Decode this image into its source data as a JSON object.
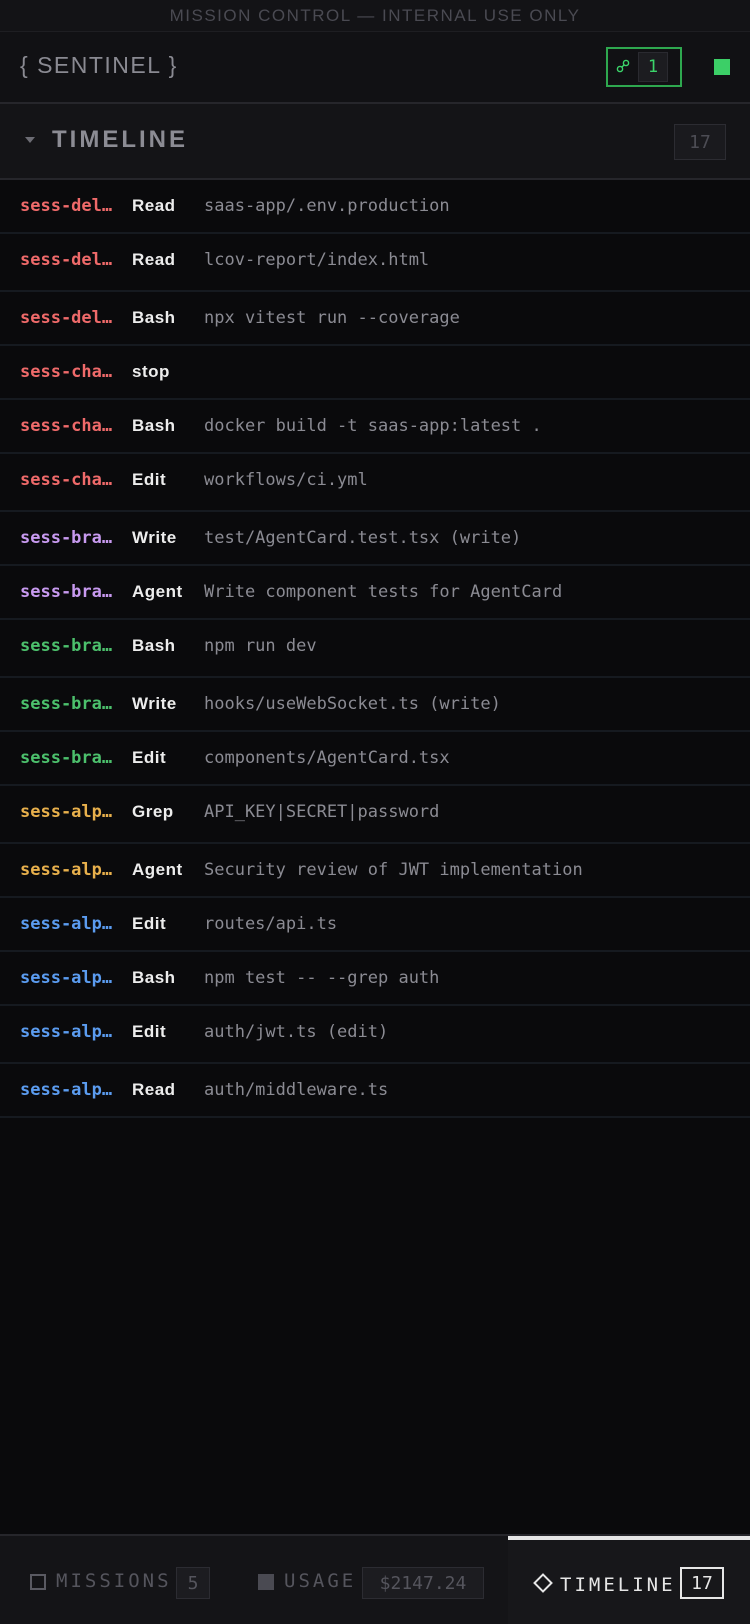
{
  "banner": {
    "text": "MISSION CONTROL — INTERNAL USE ONLY"
  },
  "header": {
    "brand": "{ SENTINEL }",
    "connections": {
      "icon": "link-icon",
      "count": "1"
    },
    "status_color": "#3ccf67"
  },
  "timeline_section": {
    "title": "TIMELINE",
    "count": "17"
  },
  "events": [
    {
      "session": "sess-del…",
      "tool": "Read",
      "detail": "saas-app/.env.production",
      "color": "#ef6a6a"
    },
    {
      "session": "sess-del…",
      "tool": "Read",
      "detail": "lcov-report/index.html",
      "color": "#ef6a6a"
    },
    {
      "session": "sess-del…",
      "tool": "Bash",
      "detail": "npx vitest run --coverage",
      "color": "#ef6a6a"
    },
    {
      "session": "sess-cha…",
      "tool": "stop",
      "detail": "",
      "color": "#ef6a6a"
    },
    {
      "session": "sess-cha…",
      "tool": "Bash",
      "detail": "docker build -t saas-app:latest .",
      "color": "#ef6a6a"
    },
    {
      "session": "sess-cha…",
      "tool": "Edit",
      "detail": "workflows/ci.yml",
      "color": "#ef6a6a"
    },
    {
      "session": "sess-bra…",
      "tool": "Write",
      "detail": "test/AgentCard.test.tsx (write)",
      "color": "#c89af0"
    },
    {
      "session": "sess-bra…",
      "tool": "Agent",
      "detail": "Write component tests for AgentCard",
      "color": "#c89af0"
    },
    {
      "session": "sess-bra…",
      "tool": "Bash",
      "detail": "npm run dev",
      "color": "#4cc06c"
    },
    {
      "session": "sess-bra…",
      "tool": "Write",
      "detail": "hooks/useWebSocket.ts (write)",
      "color": "#4cc06c"
    },
    {
      "session": "sess-bra…",
      "tool": "Edit",
      "detail": "components/AgentCard.tsx",
      "color": "#4cc06c"
    },
    {
      "session": "sess-alp…",
      "tool": "Grep",
      "detail": "API_KEY|SECRET|password",
      "color": "#e8b04c"
    },
    {
      "session": "sess-alp…",
      "tool": "Agent",
      "detail": "Security review of JWT implementation",
      "color": "#e8b04c"
    },
    {
      "session": "sess-alp…",
      "tool": "Edit",
      "detail": "routes/api.ts",
      "color": "#5b9cf0"
    },
    {
      "session": "sess-alp…",
      "tool": "Bash",
      "detail": "npm test -- --grep auth",
      "color": "#5b9cf0"
    },
    {
      "session": "sess-alp…",
      "tool": "Edit",
      "detail": "auth/jwt.ts (edit)",
      "color": "#5b9cf0"
    },
    {
      "session": "sess-alp…",
      "tool": "Read",
      "detail": "auth/middleware.ts",
      "color": "#5b9cf0"
    }
  ],
  "nav": {
    "missions": {
      "label": "MISSIONS",
      "badge": "5",
      "icon": "square-icon"
    },
    "usage": {
      "label": "USAGE",
      "badge": "$2147.24",
      "icon": "filled-square-icon"
    },
    "timeline": {
      "label": "TIMELINE",
      "badge": "17",
      "icon": "diamond-icon",
      "active": true
    }
  }
}
